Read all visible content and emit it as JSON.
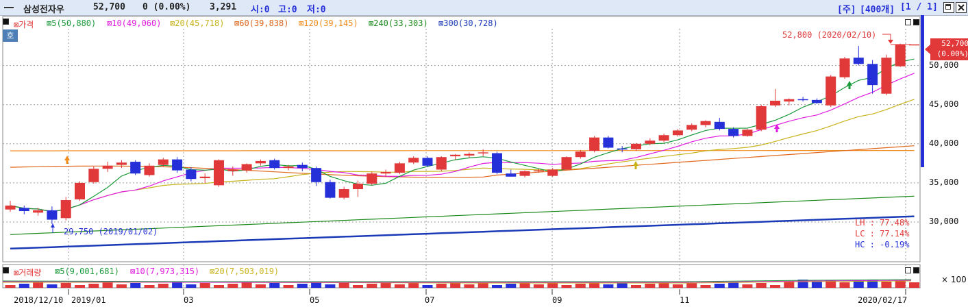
{
  "title_bar": {
    "name": "삼성전자우",
    "price": "52,700",
    "change": "0 (0.00%)",
    "volume": "3,291",
    "open": "시:0",
    "high": "고:0",
    "low": "저:0",
    "period": "[주]",
    "count": "[400개]",
    "page": "[1 / 1]"
  },
  "price_panel": {
    "legend_price": "가격",
    "ma_legend": [
      {
        "label": "5(50,880)",
        "color": "#1a9a3a"
      },
      {
        "label": "10(49,060)",
        "color": "#e01ce0"
      },
      {
        "label": "20(45,718)",
        "color": "#c8b21a"
      },
      {
        "label": "60(39,838)",
        "color": "#e0661a"
      },
      {
        "label": "120(39,145)",
        "color": "#f08a1a"
      },
      {
        "label": "240(33,303)",
        "color": "#1a8a1a"
      },
      {
        "label": "300(30,728)",
        "color": "#1a3ab8"
      }
    ],
    "ho_button": "호",
    "y_ticks": [
      "50,000",
      "45,000",
      "40,000",
      "35,000",
      "30,000"
    ],
    "high_marker": "52,800 (2020/02/10)",
    "low_marker": "29,750 (2019/01/02)",
    "current_tag": [
      "52,700",
      "(0.00%)"
    ],
    "stats": [
      "LH : 77.48%",
      "LC : 77.14%",
      "HC : -0.19%"
    ]
  },
  "volume_panel": {
    "title": "거래량",
    "ma_legend": [
      {
        "label": "5(9,001,681)",
        "color": "#1a9a3a"
      },
      {
        "label": "10(7,973,315)",
        "color": "#e01ce0"
      },
      {
        "label": "20(7,503,019)",
        "color": "#c8b21a"
      }
    ],
    "unit": "× 100"
  },
  "x_ticks": [
    "2018/12/10",
    "2019/01",
    "03",
    "05",
    "07",
    "09",
    "11",
    "2020/02/17"
  ],
  "colors": {
    "up": "#e1393a",
    "down": "#2530d8",
    "grid": "#9a9a9a"
  },
  "chart_data": {
    "type": "candlestick",
    "period": "weekly",
    "start_week": "2018-12-10",
    "end_week": "2020-02-17",
    "candles": [
      [
        31600,
        32700,
        31300,
        32100
      ],
      [
        31800,
        32100,
        31000,
        31400
      ],
      [
        31200,
        31800,
        30800,
        31500
      ],
      [
        31500,
        32000,
        29750,
        30300
      ],
      [
        30500,
        33200,
        30200,
        32800
      ],
      [
        32900,
        35200,
        32700,
        35000
      ],
      [
        35100,
        37100,
        34900,
        36800
      ],
      [
        36800,
        37700,
        36400,
        37200
      ],
      [
        37300,
        37900,
        36900,
        37600
      ],
      [
        37700,
        37900,
        36000,
        36200
      ],
      [
        36000,
        37500,
        35800,
        37200
      ],
      [
        37300,
        38200,
        37000,
        38000
      ],
      [
        38000,
        38300,
        36300,
        36600
      ],
      [
        36700,
        37000,
        35200,
        35500
      ],
      [
        35600,
        36200,
        35000,
        35800
      ],
      [
        34700,
        38000,
        34500,
        37900
      ],
      [
        36500,
        37100,
        35900,
        36700
      ],
      [
        36600,
        37500,
        36300,
        37400
      ],
      [
        37500,
        38000,
        37200,
        37800
      ],
      [
        37900,
        38100,
        36700,
        36900
      ],
      [
        36900,
        37300,
        36600,
        37100
      ],
      [
        37300,
        37600,
        36500,
        36900
      ],
      [
        36900,
        37100,
        34600,
        35100
      ],
      [
        35100,
        35400,
        33000,
        33100
      ],
      [
        33100,
        34500,
        32900,
        34200
      ],
      [
        34200,
        35300,
        33200,
        34900
      ],
      [
        34900,
        36400,
        34700,
        36200
      ],
      [
        36200,
        36700,
        35800,
        36400
      ],
      [
        36300,
        37700,
        36100,
        37500
      ],
      [
        37600,
        38400,
        37400,
        38200
      ],
      [
        38200,
        38400,
        37000,
        37200
      ],
      [
        36700,
        38400,
        36500,
        38300
      ],
      [
        38400,
        38700,
        38000,
        38600
      ],
      [
        38500,
        38900,
        38200,
        38700
      ],
      [
        38800,
        39300,
        38400,
        38900
      ],
      [
        38800,
        39000,
        36100,
        36300
      ],
      [
        36200,
        36700,
        35800,
        35800
      ],
      [
        35900,
        36600,
        35700,
        36500
      ],
      [
        36500,
        36800,
        36300,
        36600
      ],
      [
        35900,
        36900,
        35800,
        36700
      ],
      [
        36700,
        38400,
        36600,
        38300
      ],
      [
        38300,
        39200,
        38100,
        39000
      ],
      [
        39100,
        41000,
        38900,
        40800
      ],
      [
        40800,
        41000,
        39400,
        39500
      ],
      [
        39400,
        39700,
        38900,
        39300
      ],
      [
        39300,
        40100,
        39100,
        40000
      ],
      [
        40000,
        40700,
        39800,
        40400
      ],
      [
        40400,
        41300,
        40200,
        41100
      ],
      [
        41100,
        41900,
        40900,
        41700
      ],
      [
        41800,
        42600,
        41600,
        42400
      ],
      [
        42400,
        43000,
        42100,
        42900
      ],
      [
        42800,
        43300,
        41700,
        41900
      ],
      [
        41900,
        42100,
        40800,
        41000
      ],
      [
        41000,
        41900,
        40900,
        41800
      ],
      [
        41800,
        45000,
        41600,
        44800
      ],
      [
        44900,
        47000,
        44700,
        45500
      ],
      [
        45400,
        45800,
        44900,
        45700
      ],
      [
        45700,
        46000,
        45400,
        45600
      ],
      [
        45600,
        45800,
        45100,
        45200
      ],
      [
        44900,
        48800,
        44700,
        48600
      ],
      [
        48500,
        51100,
        48300,
        50900
      ],
      [
        51000,
        52500,
        50000,
        50200
      ],
      [
        50200,
        50700,
        46400,
        47500
      ],
      [
        46400,
        51400,
        46200,
        51000
      ],
      [
        49900,
        52800,
        49800,
        52700
      ],
      [
        52700,
        52700,
        52700,
        52700
      ]
    ],
    "volume_ma_values": {
      "ma5": 9001681,
      "ma10": 7973315,
      "ma20": 7503019
    },
    "ma_current": {
      "ma5": 50880,
      "ma10": 49060,
      "ma20": 45718,
      "ma60": 39838,
      "ma120": 39145,
      "ma240": 33303,
      "ma300": 30728
    },
    "ylim": [
      26000,
      54000
    ],
    "x_ticks": [
      "2018/12/10",
      "2019/01",
      "03",
      "05",
      "07",
      "09",
      "11",
      "2020/02/17"
    ],
    "high_point": {
      "value": 52800,
      "date": "2020/02/10"
    },
    "low_point": {
      "value": 29750,
      "date": "2019/01/02"
    }
  }
}
